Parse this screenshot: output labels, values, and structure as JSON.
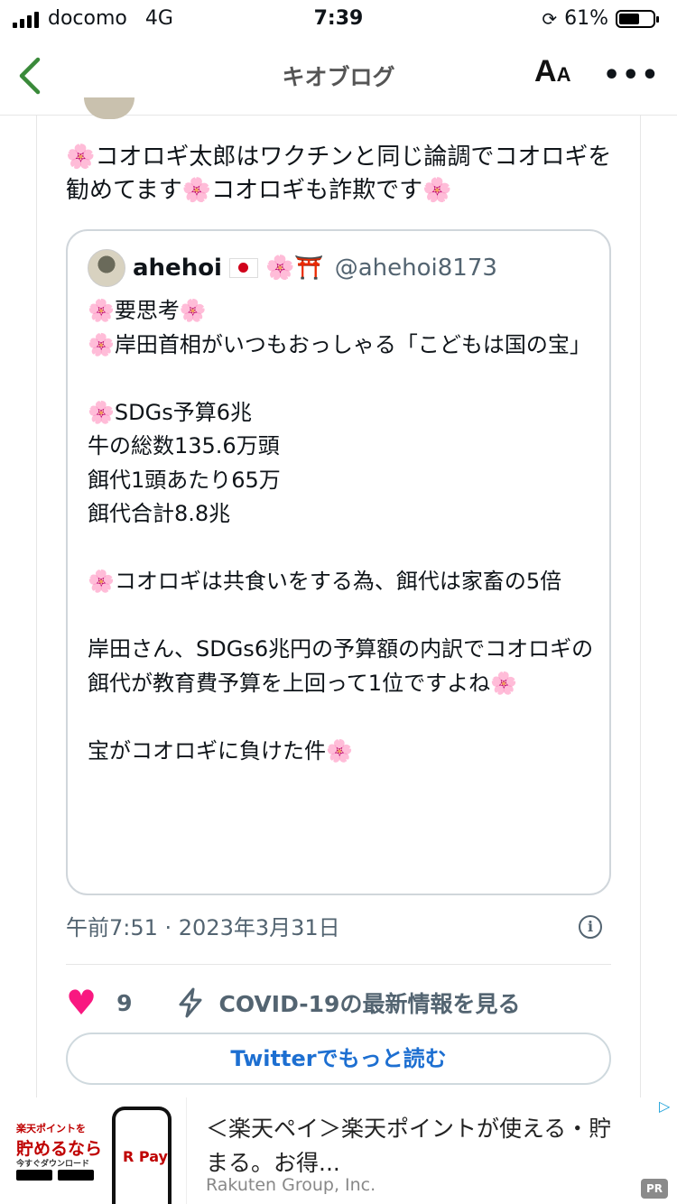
{
  "status_bar": {
    "carrier": "docomo",
    "network": "4G",
    "time": "7:39",
    "battery": "61%",
    "battery_level": 0.61
  },
  "nav": {
    "title": "キオブログ",
    "text_size_icon": "text-size-icon",
    "more": "•••"
  },
  "tweet": {
    "text": "🌸コオロギ太郎はワクチンと同じ論調でコオロギを勧めてます🌸コオロギも詐欺です🌸",
    "quote": {
      "name": "ahehoi",
      "emojis": "🌸⛩️",
      "handle": "@ahehoi8173",
      "text": "🌸要思考🌸\n🌸岸田首相がいつもおっしゃる「こどもは国の宝」\n\n🌸SDGs予算6兆\n牛の総数135.6万頭\n餌代1頭あたり65万\n餌代合計8.8兆\n\n🌸コオロギは共食いをする為、餌代は家畜の5倍\n\n岸田さん、SDGs6兆円の予算額の内訳でコオロギの餌代が教育費予算を上回って1位ですよね🌸\n\n宝がコオロギに負けた件🌸"
    },
    "timestamp": "午前7:51 · 2023年3月31日",
    "likes": "9",
    "covid_link": "COVID-19の最新情報を見る",
    "read_more": "Twitterでもっと読む"
  },
  "ad": {
    "image_line1": "楽天ポイントを",
    "image_line2": "貯めるなら",
    "image_line3": "今すぐダウンロード",
    "pay_label": "R Pay",
    "title": "＜楽天ペイ＞楽天ポイントが使える・貯まる。お得...",
    "sponsor": "Rakuten Group, Inc.",
    "badge": "PR"
  },
  "colors": {
    "accent": "#1d6fd1",
    "like": "#f91880",
    "back_arrow": "#3a8a3a",
    "muted": "#536471"
  }
}
